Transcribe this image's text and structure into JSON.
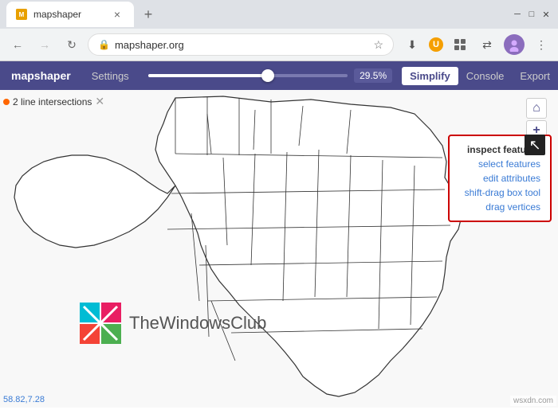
{
  "browser": {
    "tab": {
      "favicon": "M",
      "title": "mapshaper",
      "close": "×"
    },
    "new_tab": "+",
    "window_controls": {
      "minimize": "—",
      "maximize": "□",
      "close": "✕"
    },
    "address": "mapshaper.org",
    "star": "☆",
    "nav": {
      "back": "←",
      "forward": "→",
      "reload": "↻"
    },
    "right_icons": {
      "download_badge": "⬇",
      "u_badge": "U",
      "extensions": "🧩",
      "sync": "⇄",
      "menu": "⋮"
    }
  },
  "toolbar": {
    "logo": "mapshaper",
    "settings": "Settings",
    "percent": "29.5%",
    "simplify": "Simplify",
    "console": "Console",
    "export": "Export"
  },
  "notice": {
    "dot_color": "#ff6600",
    "text": "2 line intersections",
    "close": "✕"
  },
  "map_nav": {
    "home": "⌂",
    "plus": "+",
    "minus": "−"
  },
  "context_menu": {
    "cursor_icon": "↖",
    "items": [
      {
        "label": "inspect features",
        "type": "active"
      },
      {
        "label": "select features",
        "type": "link"
      },
      {
        "label": "edit attributes",
        "type": "link"
      },
      {
        "label": "shift-drag box tool",
        "type": "link"
      },
      {
        "label": "drag vertices",
        "type": "link"
      }
    ]
  },
  "coordinates": "58.82,7.28",
  "watermark": "wsxdn.com",
  "twc": {
    "text": "TheWindowsClub"
  }
}
